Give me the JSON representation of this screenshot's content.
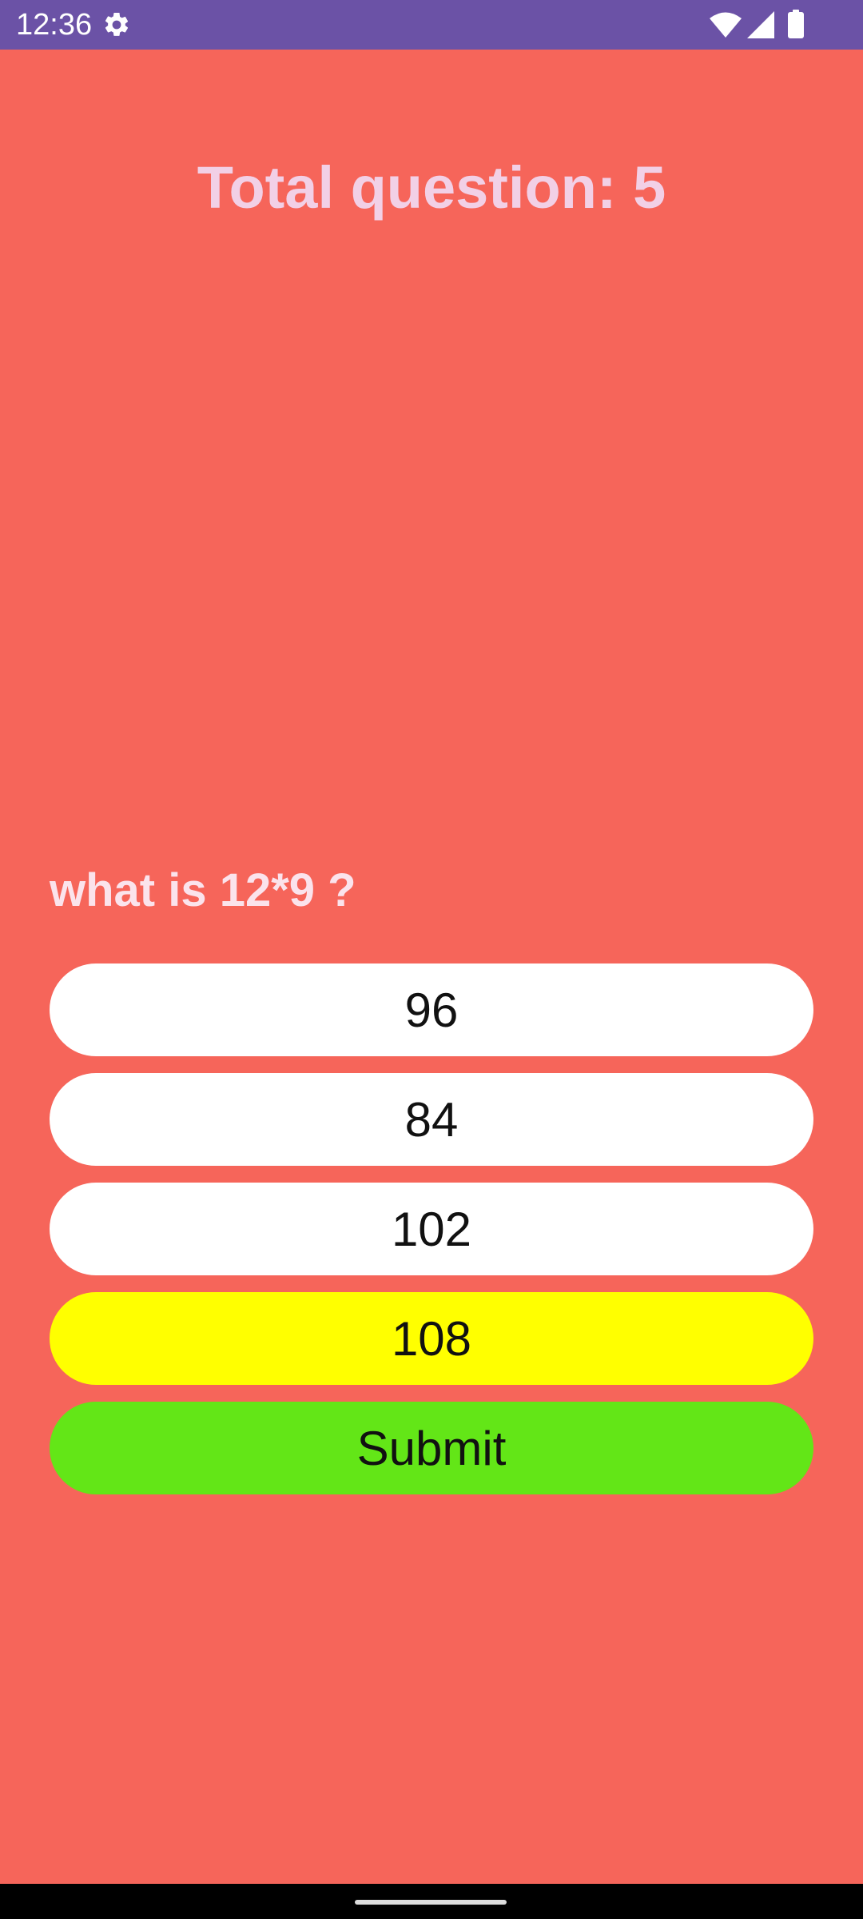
{
  "status_bar": {
    "time": "12:36",
    "icons": [
      "gear-icon",
      "wifi-icon",
      "signal-icon",
      "battery-icon"
    ],
    "background": "#6B52A6"
  },
  "quiz": {
    "total_label": "Total question: 5",
    "question": "what is 12*9 ?",
    "options": [
      "96",
      "84",
      "102",
      "108"
    ],
    "selected_option": "108",
    "submit_label": "Submit"
  },
  "colors": {
    "background": "#F6655A",
    "option_default": "#FFFFFF",
    "option_selected": "#FFFF00",
    "submit": "#63E617"
  }
}
